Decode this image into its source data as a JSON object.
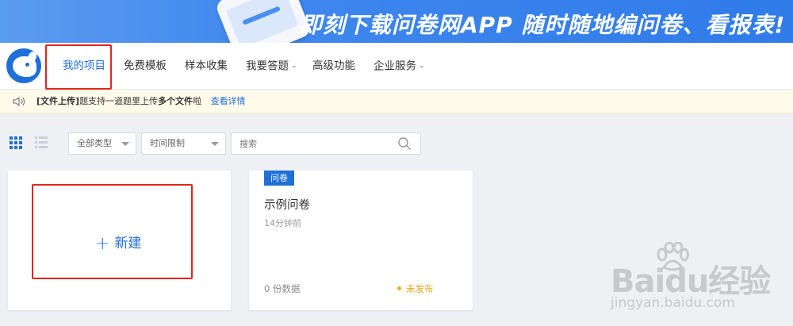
{
  "banner": {
    "text": "即刻下载问卷网APP  随时随地编问卷、看报表!"
  },
  "nav": {
    "items": [
      {
        "label": "我的项目",
        "active": true
      },
      {
        "label": "免费模板"
      },
      {
        "label": "样本收集"
      },
      {
        "label": "我要答题",
        "dropdown": true
      },
      {
        "label": "高级功能"
      },
      {
        "label": "企业服务",
        "dropdown": true
      }
    ]
  },
  "notice": {
    "prefix": "[文件上传]",
    "text_a": "题支持一道题里上传",
    "bold": "多个文件",
    "text_b": "啦",
    "link": "查看详情"
  },
  "toolbar": {
    "type_filter": "全部类型",
    "time_filter": "时间限制",
    "search_placeholder": "搜索"
  },
  "new_card": {
    "label": "新建",
    "icon": "+"
  },
  "projects": [
    {
      "badge": "问卷",
      "title": "示例问卷",
      "time": "14分钟前",
      "count": "0 份数据",
      "status": "未发布"
    }
  ],
  "watermark": {
    "main": "Baidu经验",
    "sub": "jingyan.baidu.com"
  },
  "colors": {
    "accent": "#1f6fd6",
    "status_unpublished": "#f5a623",
    "annotation": "#e0261d"
  }
}
